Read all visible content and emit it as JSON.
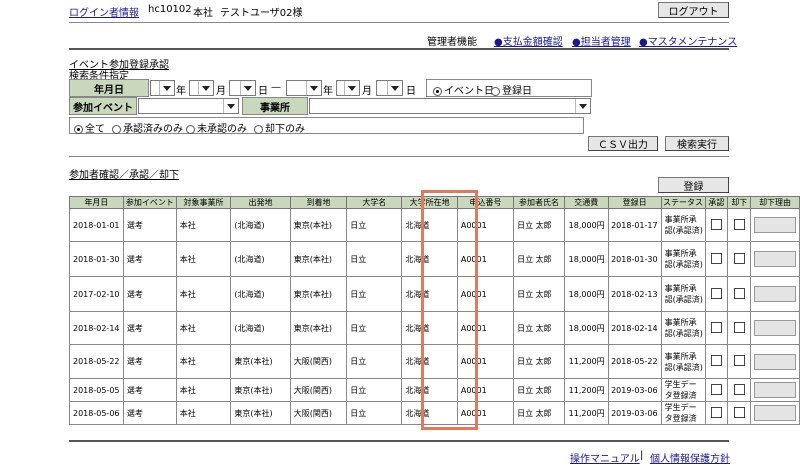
{
  "header": {
    "login_label": "ログイン者情報",
    "user_id": "hc10102",
    "office": "本社",
    "user_name": "テストユーザ02様",
    "logout_label": "ログアウト"
  },
  "admin": {
    "label": "管理者機能",
    "links": [
      "●支払金額確認",
      "●担当者管理",
      "●マスタメンテナンス"
    ]
  },
  "event_section": {
    "title": "イベント参加登録承認",
    "subtitle": "検索条件指定"
  },
  "search": {
    "date_label": "年月日",
    "year": "年",
    "month": "月",
    "day": "日",
    "range_sep": "—",
    "date_type_options": [
      "イベント日",
      "登録日"
    ],
    "date_type_selected": "イベント日",
    "event_label": "参加イベント",
    "office_label": "事業所",
    "status_options": [
      "全て",
      "承認済みのみ",
      "未承認のみ",
      "却下のみ"
    ],
    "status_selected": "全て",
    "csv_label": "ＣＳＶ出力",
    "search_label": "検索実行"
  },
  "results": {
    "title": "参加者確認／承認／却下",
    "register_label": "登録",
    "columns": [
      "年月日",
      "参加イベント",
      "対象事業所",
      "出発地",
      "到着地",
      "大学名",
      "大学所在地",
      "申込番号",
      "参加者氏名",
      "交通費",
      "登録日",
      "ステータス",
      "承認",
      "却下",
      "却下理由"
    ],
    "rows": [
      {
        "date": "2018-01-01",
        "event": "選考",
        "office": "本社",
        "from": "(北海道)",
        "to": "東京(本社)",
        "univ": "日立",
        "univ_loc": "北海道",
        "app_no": "A0001",
        "name": "日立 太郎",
        "fare": "18,000円",
        "reg_date": "2018-01-17",
        "status": "事業所承認(承認済)"
      },
      {
        "date": "2018-01-30",
        "event": "選考",
        "office": "本社",
        "from": "(北海道)",
        "to": "東京(本社)",
        "univ": "日立",
        "univ_loc": "北海道",
        "app_no": "A0001",
        "name": "日立 太郎",
        "fare": "18,000円",
        "reg_date": "2018-01-30",
        "status": "事業所承認(承認済)"
      },
      {
        "date": "2017-02-10",
        "event": "選考",
        "office": "本社",
        "from": "(北海道)",
        "to": "東京(本社)",
        "univ": "日立",
        "univ_loc": "北海道",
        "app_no": "A0001",
        "name": "日立 太郎",
        "fare": "18,000円",
        "reg_date": "2018-02-13",
        "status": "事業所承認(承認済)"
      },
      {
        "date": "2018-02-14",
        "event": "選考",
        "office": "本社",
        "from": "(北海道)",
        "to": "東京(本社)",
        "univ": "日立",
        "univ_loc": "北海道",
        "app_no": "A0001",
        "name": "日立 太郎",
        "fare": "18,000円",
        "reg_date": "2018-02-14",
        "status": "事業所承認(承認済)"
      },
      {
        "date": "2018-05-22",
        "event": "選考",
        "office": "本社",
        "from": "東京(本社)",
        "to": "大阪(関西)",
        "univ": "日立",
        "univ_loc": "北海道",
        "app_no": "A0001",
        "name": "日立 太郎",
        "fare": "11,200円",
        "reg_date": "2018-05-22",
        "status": "事業所承認(承認済)"
      },
      {
        "date": "2018-05-05",
        "event": "選考",
        "office": "本社",
        "from": "東京(本社)",
        "to": "大阪(関西)",
        "univ": "日立",
        "univ_loc": "北海道",
        "app_no": "A0001",
        "name": "日立 太郎",
        "fare": "11,200円",
        "reg_date": "2019-03-06",
        "status": "学生データ登録済"
      },
      {
        "date": "2018-05-06",
        "event": "選考",
        "office": "本社",
        "from": "東京(本社)",
        "to": "大阪(関西)",
        "univ": "日立",
        "univ_loc": "北海道",
        "app_no": "A0001",
        "name": "日立 太郎",
        "fare": "11,200円",
        "reg_date": "2019-03-06",
        "status": "学生データ登録済"
      }
    ]
  },
  "footer": {
    "manual_label": "操作マニュアル",
    "sep": "|",
    "privacy_label": "個人情報保護方針"
  },
  "colors": {
    "label_bg": "#c9d8bd",
    "highlight": "#e07a5f",
    "link": "#1a1a8c"
  }
}
